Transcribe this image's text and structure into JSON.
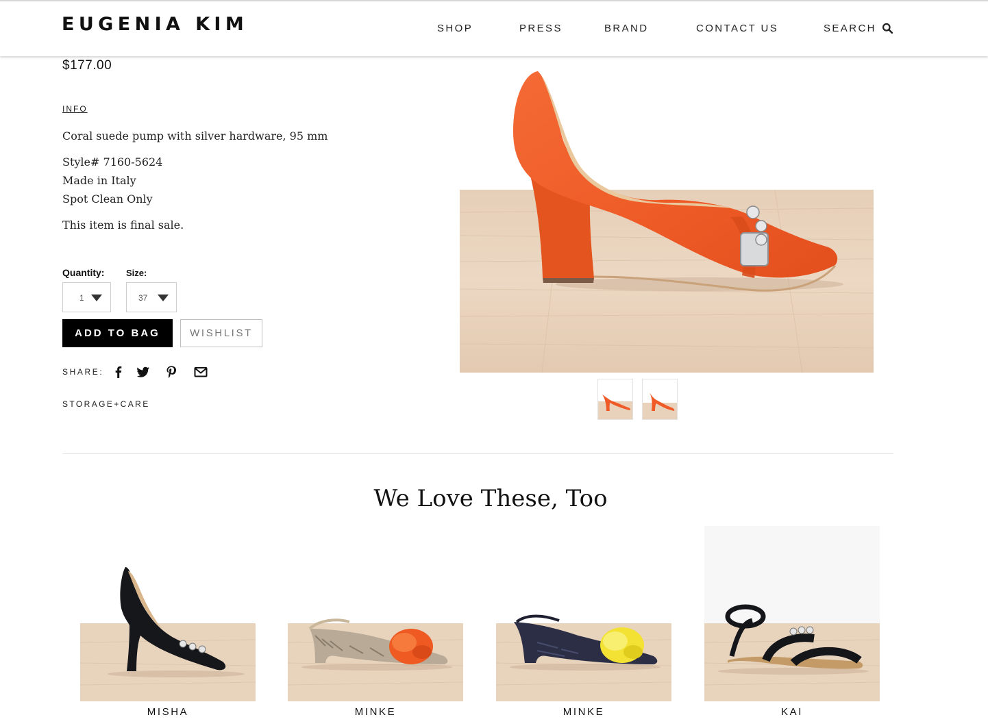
{
  "header": {
    "logo": "EUGENIA KIM",
    "nav": [
      "SHOP",
      "PRESS",
      "BRAND",
      "CONTACT US",
      "SEARCH"
    ]
  },
  "product": {
    "price": "$177.00",
    "info_label": "INFO",
    "description": "Coral suede pump with silver hardware, 95 mm",
    "style": "Style# 7160-5624",
    "origin": "Made in Italy",
    "care": "Spot Clean Only",
    "final_sale": "This item is final sale.",
    "quantity_label": "Quantity:",
    "quantity_value": "1",
    "size_label": "Size:",
    "size_value": "37",
    "add_to_bag": "ADD TO BAG",
    "wishlist": "WISHLIST",
    "share_label": "SHARE:",
    "storage_label": "STORAGE+CARE"
  },
  "section": {
    "title": "We Love These, Too"
  },
  "related": [
    {
      "name": "MISHA"
    },
    {
      "name": "MINKE"
    },
    {
      "name": "MINKE"
    },
    {
      "name": "KAI"
    }
  ],
  "colors": {
    "accent": "#000000",
    "shoe_coral": "#F05A28",
    "wood_floor": "#E9D3BC"
  },
  "icons": {
    "search": "search-icon",
    "facebook": "facebook-icon",
    "twitter": "twitter-icon",
    "pinterest": "pinterest-icon",
    "email": "email-icon"
  }
}
